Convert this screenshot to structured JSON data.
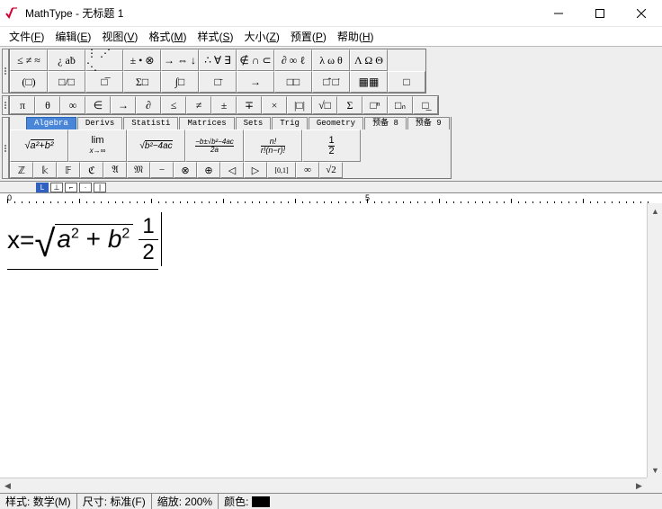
{
  "titlebar": {
    "app_name": "MathType",
    "doc_name": "无标题 1",
    "separator": " - "
  },
  "menubar": {
    "items": [
      {
        "label": "文件",
        "accel": "F"
      },
      {
        "label": "编辑",
        "accel": "E"
      },
      {
        "label": "视图",
        "accel": "V"
      },
      {
        "label": "格式",
        "accel": "M"
      },
      {
        "label": "样式",
        "accel": "S"
      },
      {
        "label": "大小",
        "accel": "Z"
      },
      {
        "label": "预置",
        "accel": "P"
      },
      {
        "label": "帮助",
        "accel": "H"
      }
    ]
  },
  "toolbar": {
    "row1": [
      "≤ ≠ ≈",
      "¿ aḃ",
      "⋮ ⋰ ⋱",
      "± • ⊗",
      "→ ⇔ ↓",
      "∴ ∀ ∃",
      "∉ ∩ ⊂",
      "∂ ∞ ℓ",
      "λ ω θ",
      "Λ Ω Θ"
    ],
    "row2": [
      "(□)",
      "□/□",
      "□̅",
      "Σ□",
      "∫□",
      "□̄",
      "→",
      "□□",
      "□̂ □̇",
      "▦▦",
      "□"
    ],
    "row3": [
      "π",
      "θ",
      "∞",
      "∈",
      "→",
      "∂",
      "≤",
      "≠",
      "±",
      "∓",
      "×",
      "|□|",
      "√□",
      "Σ",
      "□ⁿ",
      "□ₙ",
      "□̲"
    ]
  },
  "tabs": {
    "items": [
      {
        "label": "Algebra",
        "active": true
      },
      {
        "label": "Derivs",
        "active": false
      },
      {
        "label": "Statisti",
        "active": false
      },
      {
        "label": "Matrices",
        "active": false
      },
      {
        "label": "Sets",
        "active": false
      },
      {
        "label": "Trig",
        "active": false
      },
      {
        "label": "Geometry",
        "active": false
      },
      {
        "label": "预备 8",
        "active": false
      },
      {
        "label": "预备 9",
        "active": false
      }
    ]
  },
  "templates": {
    "items": [
      "sqrt_a2b2",
      "lim_xinf",
      "sqrt_b24ac",
      "quad_formula",
      "binom",
      "one_half"
    ]
  },
  "smallbar": {
    "items": [
      "ℤ",
      "𝕜",
      "𝔽",
      "ℭ",
      "𝔄",
      "𝔐",
      "−",
      "⊗",
      "⊕",
      "◁",
      "▷",
      "[0,1]",
      "∞",
      "√2"
    ]
  },
  "ruler": {
    "marks": [
      {
        "pos": 8,
        "label": "0"
      },
      {
        "pos": 406,
        "label": "5"
      }
    ]
  },
  "equation": {
    "lhs": "x=",
    "radicand_a": "a",
    "sup_a": "2",
    "plus": " + ",
    "radicand_b": "b",
    "sup_b": "2",
    "frac_num": "1",
    "frac_den": "2"
  },
  "statusbar": {
    "style_label": "样式:",
    "style_value": "数学(M)",
    "size_label": "尺寸:",
    "size_value": "标准(F)",
    "zoom_label": "缩放:",
    "zoom_value": "200%",
    "color_label": "颜色:"
  }
}
